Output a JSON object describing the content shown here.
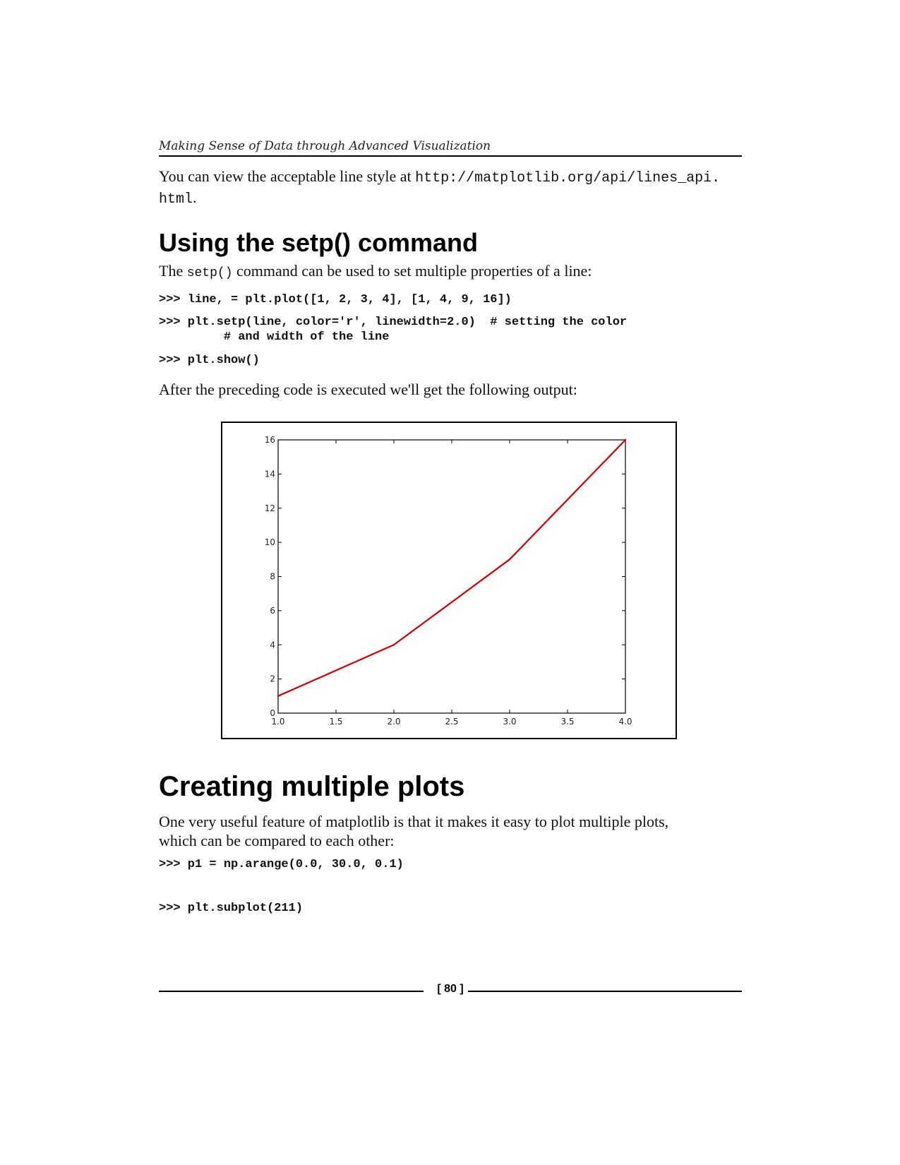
{
  "header": {
    "running_title": "Making Sense of Data through Advanced Visualization"
  },
  "intro": {
    "text": "You can view the acceptable line style at ",
    "url_part1": "http://matplotlib.org/api/lines_api.",
    "url_part2": "html",
    "period": "."
  },
  "section1": {
    "heading": "Using the setp() command",
    "para_pre": "The ",
    "para_code": "setp()",
    "para_post": " command can be used to set multiple properties of a line:",
    "code_lines": [
      ">>> line, = plt.plot([1, 2, 3, 4], [1, 4, 9, 16])",
      ">>> plt.setp(line, color='r', linewidth=2.0)  # setting the color",
      "         # and width of the line",
      ">>> plt.show()"
    ],
    "after_text": "After the preceding code is executed we'll get the following output:"
  },
  "chart_data": {
    "type": "line",
    "x": [
      1,
      2,
      3,
      4
    ],
    "series": [
      {
        "values": [
          1,
          4,
          9,
          16
        ],
        "color": "#d40000"
      }
    ],
    "xlim": [
      1.0,
      4.0
    ],
    "ylim": [
      0,
      16
    ],
    "xticks": [
      "1.0",
      "1.5",
      "2.0",
      "2.5",
      "3.0",
      "3.5",
      "4.0"
    ],
    "yticks": [
      "0",
      "2",
      "4",
      "6",
      "8",
      "10",
      "12",
      "14",
      "16"
    ],
    "title": "",
    "xlabel": "",
    "ylabel": "",
    "grid": false
  },
  "section2": {
    "heading": "Creating multiple plots",
    "para_line1": "One very useful feature of matplotlib is that it makes it easy to plot multiple plots,",
    "para_line2": "which can be compared to each other:",
    "code_line1": ">>> p1 = np.arange(0.0, 30.0, 0.1)",
    "code_line2": ">>> plt.subplot(211)"
  },
  "footer": {
    "page_number": "[ 80 ]"
  }
}
